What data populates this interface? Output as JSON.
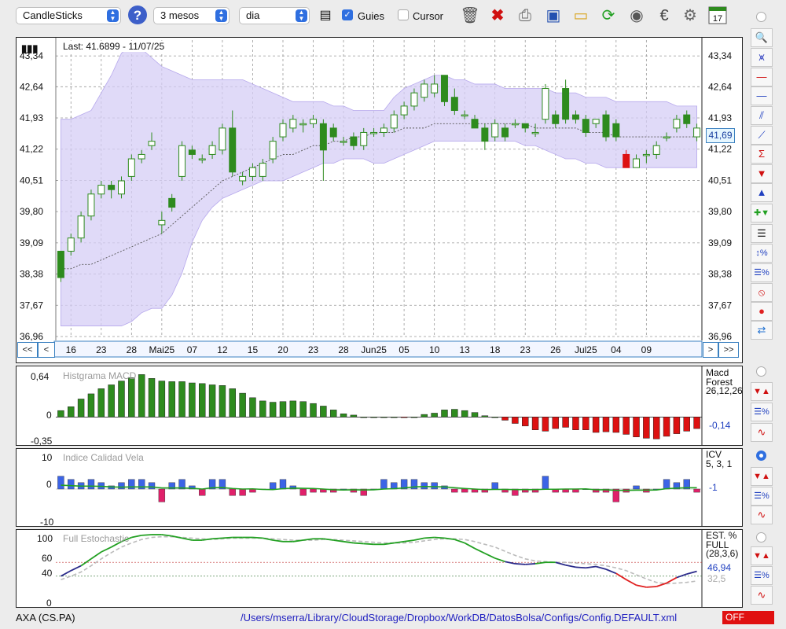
{
  "toolbar": {
    "chart_type": "CandleSticks",
    "period": "3 mesos",
    "interval": "dia",
    "guides_label": "Guies",
    "guides_checked": true,
    "cursor_label": "Cursor",
    "cursor_checked": false,
    "icons": [
      "help-icon",
      "calendar-window-icon",
      "trash-icon",
      "delete-icon",
      "print-icon",
      "save-icon",
      "open-folder-icon",
      "refresh-icon",
      "download-icon",
      "euro-icon",
      "settings-icon",
      "calendar-icon"
    ],
    "calendar_day": "17"
  },
  "main_chart": {
    "last_label": "Last: 41.6899 - 11/07/25",
    "price_badge": "41,69",
    "y_ticks": [
      "43,34",
      "42,64",
      "41,93",
      "41,22",
      "40,51",
      "39,80",
      "39,09",
      "38,38",
      "37,67",
      "36,96"
    ],
    "x_labels": [
      "16",
      "23",
      "28",
      "Mai25",
      "07",
      "12",
      "15",
      "20",
      "23",
      "28",
      "Jun25",
      "05",
      "10",
      "13",
      "18",
      "23",
      "26",
      "Jul25",
      "04",
      "09"
    ],
    "nav": {
      "first": "<<",
      "prev": "<",
      "next": ">",
      "last": ">>"
    }
  },
  "macd": {
    "title": "Histgrama MACD",
    "y_ticks": [
      "0,64",
      "0",
      "-0,35"
    ],
    "legend": [
      "Macd",
      "Forest",
      "26,12,26"
    ],
    "value": "-0,14"
  },
  "icv": {
    "title": "Indice Calidad Vela",
    "y_ticks": [
      "10",
      "0",
      "-10"
    ],
    "legend": [
      "ICV",
      "5, 3, 1"
    ],
    "value": "-1"
  },
  "stoch": {
    "title": "Full Estochastic",
    "y_ticks": [
      "100",
      "60",
      "40",
      "0"
    ],
    "legend": [
      "EST. %",
      "FULL",
      "(28,3,6)"
    ],
    "value1": "46,94",
    "value2": "32,5"
  },
  "status": {
    "symbol": "AXA (CS.PA)",
    "path": "/Users/mserra/Library/CloudStorage/Dropbox/WorkDB/DatosBolsa/Configs/Config.DEFAULT.xml",
    "off": "OFF"
  },
  "colors": {
    "up": "#2e8b1e",
    "down": "#dd1111",
    "band": "#d6cef5",
    "pos": "#2e8b1e",
    "neg": "#dd1111",
    "icv_pos": "#3c64e6",
    "icv_neg": "#e0206a"
  },
  "chart_data": [
    {
      "type": "candlestick",
      "ylim": [
        36.96,
        43.7
      ],
      "candles": [
        [
          38.9,
          38.3,
          38.9,
          38.2
        ],
        [
          38.9,
          39.2,
          39.3,
          38.8
        ],
        [
          39.2,
          39.7,
          39.8,
          39.1
        ],
        [
          39.7,
          40.2,
          40.3,
          39.6
        ],
        [
          40.2,
          40.4,
          40.5,
          40.1
        ],
        [
          40.4,
          40.3,
          40.5,
          40.1
        ],
        [
          40.2,
          40.5,
          40.6,
          40.1
        ],
        [
          40.6,
          41.0,
          41.1,
          40.5
        ],
        [
          41.0,
          41.1,
          41.2,
          40.9
        ],
        [
          41.3,
          41.4,
          41.6,
          41.2
        ],
        [
          39.5,
          39.6,
          39.8,
          39.3
        ],
        [
          40.1,
          39.9,
          40.2,
          39.8
        ],
        [
          40.6,
          41.3,
          41.4,
          40.5
        ],
        [
          41.2,
          41.1,
          41.3,
          41.0
        ],
        [
          41.0,
          41.0,
          41.1,
          40.9
        ],
        [
          41.1,
          41.3,
          41.4,
          41.0
        ],
        [
          41.2,
          41.7,
          41.8,
          41.1
        ],
        [
          41.7,
          40.7,
          42.1,
          40.6
        ],
        [
          40.5,
          40.6,
          40.7,
          40.4
        ],
        [
          40.6,
          40.8,
          40.9,
          40.5
        ],
        [
          40.6,
          40.9,
          41.0,
          40.5
        ],
        [
          41.0,
          41.4,
          41.5,
          40.9
        ],
        [
          41.5,
          41.8,
          41.9,
          41.4
        ],
        [
          41.7,
          41.9,
          42.0,
          41.6
        ],
        [
          41.8,
          41.8,
          41.9,
          41.6
        ],
        [
          41.8,
          41.9,
          42.0,
          41.7
        ],
        [
          41.8,
          41.2,
          41.9,
          40.5
        ],
        [
          41.7,
          41.5,
          41.8,
          41.4
        ],
        [
          41.4,
          41.4,
          41.5,
          41.3
        ],
        [
          41.5,
          41.3,
          41.6,
          41.2
        ],
        [
          41.3,
          41.6,
          41.7,
          41.2
        ],
        [
          41.6,
          41.6,
          41.7,
          41.5
        ],
        [
          41.6,
          41.7,
          41.8,
          41.5
        ],
        [
          41.7,
          42.0,
          42.1,
          41.6
        ],
        [
          42.0,
          42.2,
          42.3,
          41.9
        ],
        [
          42.2,
          42.5,
          42.6,
          42.1
        ],
        [
          42.4,
          42.7,
          42.8,
          42.3
        ],
        [
          42.5,
          42.7,
          42.9,
          42.4
        ],
        [
          42.9,
          42.3,
          42.9,
          42.2
        ],
        [
          42.4,
          42.1,
          42.6,
          42.0
        ],
        [
          42.0,
          42.0,
          42.1,
          41.9
        ],
        [
          41.9,
          41.7,
          42.0,
          41.8
        ],
        [
          41.7,
          41.4,
          41.8,
          41.2
        ],
        [
          41.5,
          41.8,
          41.9,
          41.4
        ],
        [
          41.7,
          41.5,
          41.8,
          41.4
        ],
        [
          41.8,
          41.8,
          41.9,
          41.7
        ],
        [
          41.8,
          41.7,
          41.8,
          41.6
        ],
        [
          41.6,
          41.6,
          41.8,
          41.5
        ],
        [
          41.9,
          42.6,
          42.7,
          41.8
        ],
        [
          42.0,
          41.8,
          42.1,
          41.7
        ],
        [
          42.6,
          41.9,
          42.8,
          41.8
        ],
        [
          42.0,
          41.9,
          42.1,
          41.8
        ],
        [
          41.9,
          41.6,
          42.0,
          41.5
        ],
        [
          41.8,
          41.9,
          41.9,
          41.7
        ],
        [
          42.0,
          41.5,
          42.1,
          41.4
        ],
        [
          41.8,
          41.5,
          41.9,
          41.4
        ],
        [
          41.1,
          40.8,
          41.2,
          40.8
        ],
        [
          40.8,
          41.0,
          41.1,
          40.9
        ],
        [
          41.1,
          41.1,
          41.2,
          40.9
        ],
        [
          41.1,
          41.3,
          41.4,
          41.0
        ],
        [
          41.5,
          41.5,
          41.6,
          41.4
        ],
        [
          41.7,
          41.9,
          42.0,
          41.6
        ],
        [
          42.0,
          41.8,
          42.1,
          41.7
        ],
        [
          41.5,
          41.7,
          41.8,
          41.4
        ]
      ],
      "series": [
        {
          "type": "line",
          "values": [
            38.5,
            38.5,
            38.6,
            38.6,
            38.7,
            38.8,
            38.9,
            39.0,
            39.1,
            39.2,
            39.3,
            39.5,
            39.7,
            39.9,
            40.1,
            40.3,
            40.5,
            40.6,
            40.7,
            40.8,
            40.9,
            41.0,
            41.1,
            41.1,
            41.2,
            41.3,
            41.3,
            41.4,
            41.4,
            41.5,
            41.5,
            41.6,
            41.6,
            41.6,
            41.7,
            41.7,
            41.7,
            41.8,
            41.8,
            41.8,
            41.8,
            41.8,
            41.8,
            41.8,
            41.8,
            41.8,
            41.8,
            41.7,
            41.7,
            41.7,
            41.7,
            41.7,
            41.6,
            41.6,
            41.6,
            41.5,
            41.5,
            41.5,
            41.5,
            41.5,
            41.5,
            41.5,
            41.5,
            41.5
          ]
        },
        {
          "type": "area",
          "upper": [
            41.9,
            41.9,
            42.0,
            42.1,
            42.5,
            42.9,
            43.4,
            43.6,
            43.5,
            43.3,
            43.1,
            43.0,
            42.9,
            42.8,
            42.8,
            42.8,
            42.8,
            42.8,
            42.8,
            42.7,
            42.6,
            42.5,
            42.4,
            42.3,
            42.3,
            42.3,
            42.3,
            42.2,
            42.2,
            42.1,
            42.1,
            42.1,
            42.1,
            42.4,
            42.6,
            42.7,
            42.8,
            42.9,
            42.9,
            42.8,
            42.8,
            42.7,
            42.7,
            42.7,
            42.6,
            42.6,
            42.6,
            42.6,
            42.6,
            42.5,
            42.5,
            42.5,
            42.4,
            42.4,
            42.4,
            42.3,
            42.3,
            42.3,
            42.3,
            42.3,
            42.3,
            42.2,
            42.2,
            42.2
          ],
          "lower": [
            37.2,
            37.2,
            37.2,
            37.2,
            37.2,
            37.2,
            37.2,
            37.3,
            37.5,
            37.6,
            37.6,
            37.9,
            38.4,
            39.1,
            39.6,
            39.9,
            40.1,
            40.2,
            40.3,
            40.4,
            40.5,
            40.5,
            40.5,
            40.6,
            40.7,
            40.8,
            40.9,
            40.9,
            41.0,
            41.0,
            41.0,
            40.9,
            40.9,
            41.0,
            41.1,
            41.2,
            41.3,
            41.4,
            41.4,
            41.4,
            41.4,
            41.4,
            41.4,
            41.4,
            41.4,
            41.4,
            41.3,
            41.3,
            41.2,
            41.1,
            41.0,
            41.0,
            40.9,
            40.9,
            40.8,
            40.8,
            40.8,
            40.8,
            40.8,
            40.8,
            40.8,
            40.8,
            40.8,
            40.8
          ]
        }
      ]
    },
    {
      "type": "bar",
      "name": "Histgrama MACD",
      "ylim": [
        -0.35,
        0.64
      ],
      "values": [
        0.1,
        0.16,
        0.28,
        0.36,
        0.44,
        0.5,
        0.56,
        0.61,
        0.66,
        0.6,
        0.56,
        0.55,
        0.55,
        0.53,
        0.52,
        0.5,
        0.49,
        0.44,
        0.37,
        0.3,
        0.25,
        0.23,
        0.24,
        0.25,
        0.24,
        0.21,
        0.17,
        0.11,
        0.05,
        0.03,
        0,
        0,
        0,
        0,
        -0.01,
        0,
        0.04,
        0.06,
        0.11,
        0.12,
        0.1,
        0.07,
        0.02,
        0,
        -0.05,
        -0.1,
        -0.14,
        -0.2,
        -0.22,
        -0.18,
        -0.16,
        -0.2,
        -0.2,
        -0.24,
        -0.23,
        -0.24,
        -0.27,
        -0.31,
        -0.33,
        -0.34,
        -0.3,
        -0.26,
        -0.22,
        -0.18
      ]
    },
    {
      "type": "bar",
      "name": "Indice Calidad Vela",
      "ylim": [
        -10,
        10
      ],
      "values": [
        4,
        3,
        2,
        3,
        2,
        1,
        2,
        3,
        3,
        2,
        -4,
        2,
        3,
        1,
        -2,
        3,
        3,
        -2,
        -2,
        -1,
        0,
        2,
        3,
        1,
        -2,
        -1,
        -1,
        -1,
        0,
        -1,
        -2,
        0,
        3,
        2,
        3,
        3,
        2,
        2,
        1,
        -1,
        -1,
        -1,
        -1,
        2,
        -1,
        -2,
        -1,
        -1,
        4,
        -1,
        -1,
        -1,
        0,
        -1,
        -1,
        -4,
        -1,
        1,
        -1,
        0,
        3,
        2,
        3,
        -1
      ]
    },
    {
      "type": "line",
      "name": "Full Estochastic",
      "ylim": [
        0,
        100
      ],
      "series": [
        {
          "values": [
            40,
            48,
            55,
            65,
            75,
            82,
            90,
            96,
            99,
            100,
            100,
            98,
            95,
            92,
            92,
            94,
            95,
            96,
            96,
            96,
            95,
            92,
            90,
            90,
            92,
            94,
            94,
            92,
            90,
            88,
            87,
            86,
            86,
            88,
            90,
            92,
            95,
            96,
            95,
            93,
            88,
            80,
            73,
            66,
            61,
            58,
            57,
            58,
            60,
            60,
            56,
            53,
            52,
            54,
            50,
            44,
            35,
            27,
            24,
            25,
            30,
            38,
            43,
            47
          ]
        },
        {
          "values": [
            35,
            40,
            46,
            55,
            65,
            74,
            82,
            88,
            93,
            96,
            97,
            97,
            96,
            95,
            94,
            93,
            94,
            95,
            95,
            95,
            95,
            94,
            93,
            92,
            92,
            92,
            93,
            93,
            92,
            91,
            90,
            89,
            88,
            88,
            88,
            89,
            91,
            93,
            94,
            94,
            93,
            90,
            86,
            82,
            76,
            70,
            65,
            62,
            61,
            60,
            60,
            59,
            58,
            57,
            55,
            52,
            48,
            42,
            36,
            31,
            29,
            30,
            31,
            33
          ]
        }
      ],
      "hlines": [
        60,
        40
      ]
    }
  ]
}
